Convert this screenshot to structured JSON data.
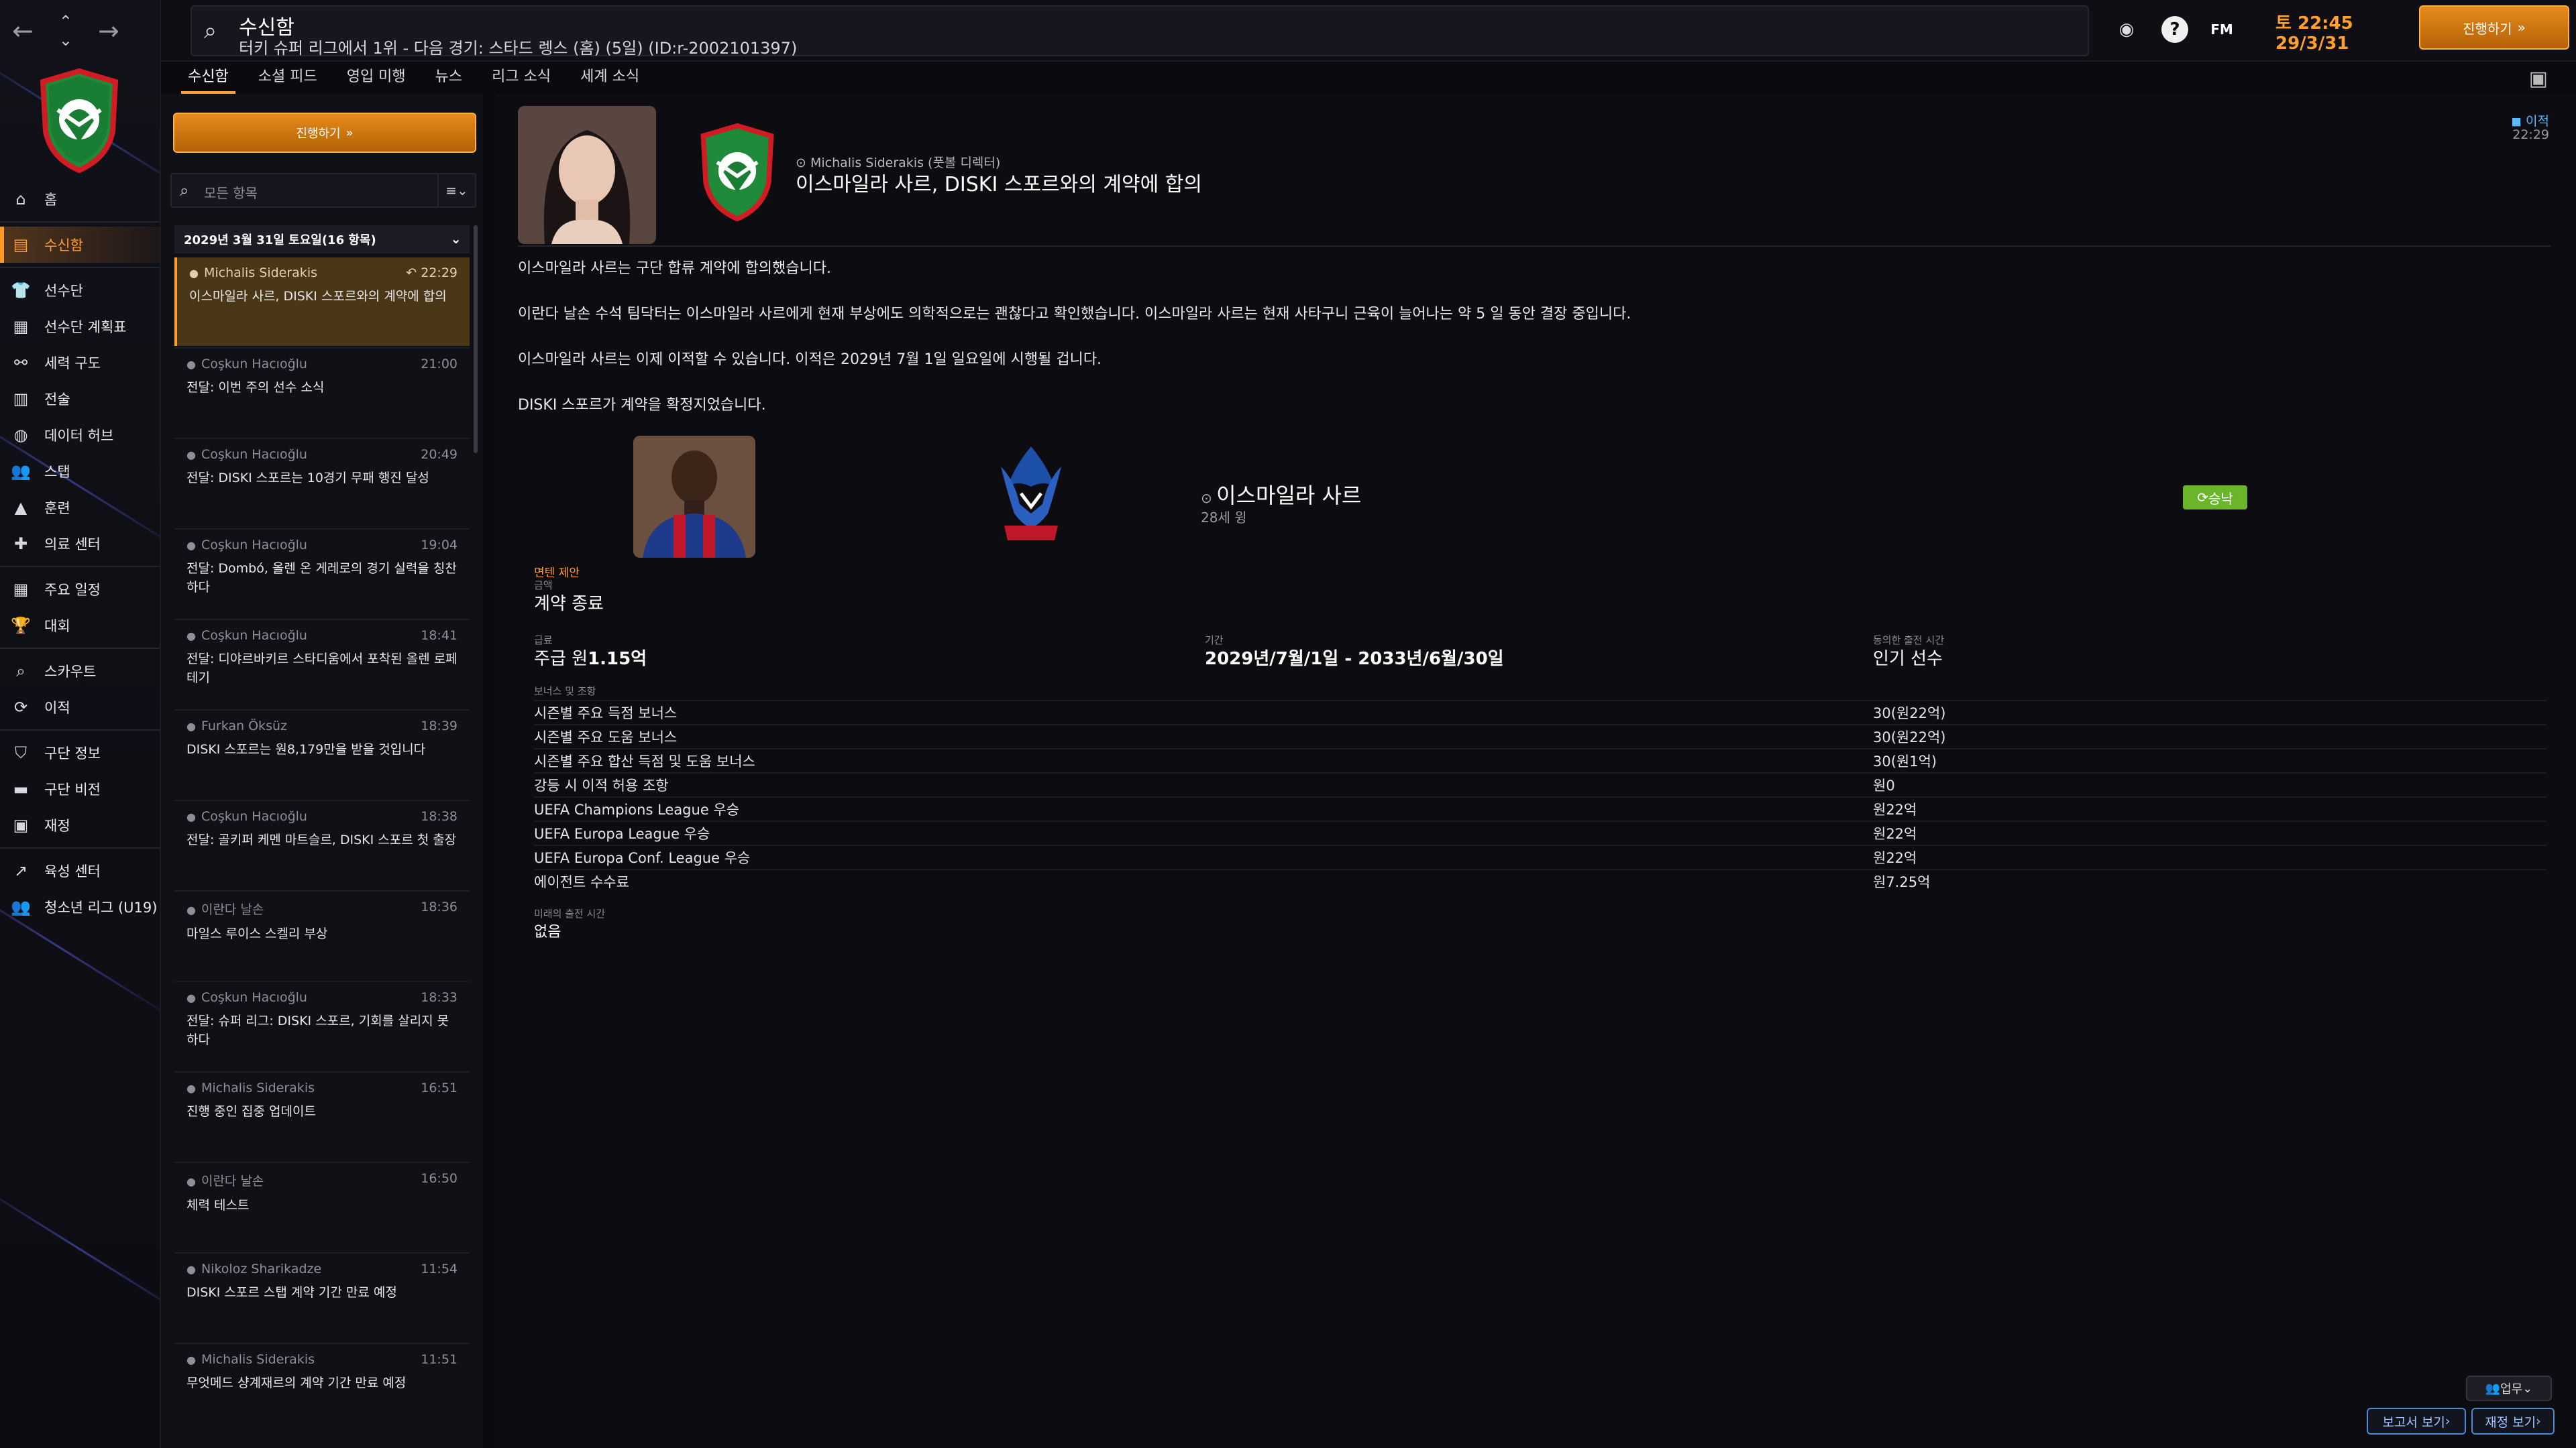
{
  "topbar": {
    "title": "수신함",
    "subtitle": "터키 슈퍼 리그에서 1위 - 다음 경기: 스타드 렝스 (홈) (5일) (ID:r-2002101397)",
    "fm_label": "FM",
    "day": "토 22:45",
    "date": "29/3/31",
    "continue_label": "진행하기"
  },
  "sidebar": {
    "items": [
      {
        "label": "홈",
        "icon": "home-icon"
      },
      {
        "label": "수신함",
        "icon": "inbox-icon",
        "active": true
      },
      {
        "label": "선수단",
        "icon": "squad-icon"
      },
      {
        "label": "선수단 계획표",
        "icon": "clipboard-icon"
      },
      {
        "label": "세력 구도",
        "icon": "dynamics-icon"
      },
      {
        "label": "전술",
        "icon": "tactics-icon"
      },
      {
        "label": "데이터 허브",
        "icon": "data-icon"
      },
      {
        "label": "스탭",
        "icon": "staff-icon"
      },
      {
        "label": "훈련",
        "icon": "training-icon"
      },
      {
        "label": "의료 센터",
        "icon": "medical-icon"
      },
      {
        "label": "주요 일정",
        "icon": "calendar-icon"
      },
      {
        "label": "대회",
        "icon": "trophy-icon"
      },
      {
        "label": "스카우트",
        "icon": "scout-icon"
      },
      {
        "label": "이적",
        "icon": "transfer-icon"
      },
      {
        "label": "구단 정보",
        "icon": "shield-icon"
      },
      {
        "label": "구단 비전",
        "icon": "vision-icon"
      },
      {
        "label": "재정",
        "icon": "finance-icon"
      },
      {
        "label": "육성 센터",
        "icon": "development-icon"
      },
      {
        "label": "청소년 리그 (U19)",
        "icon": "youth-icon"
      }
    ]
  },
  "tabs": [
    "수신함",
    "소셜 피드",
    "영입 미행",
    "뉴스",
    "리그 소식",
    "세계 소식"
  ],
  "list": {
    "continue_label": "진행하기",
    "filter_placeholder": "모든 항목",
    "day_header": "2029년 3월 31일 토요일(16 항목)",
    "messages": [
      {
        "from": "Michalis Siderakis",
        "time": "22:29",
        "subject": "이스마일라 사르, DISKI 스포르와의 계약에 합의"
      },
      {
        "from": "Coşkun Hacıoğlu",
        "time": "21:00",
        "subject": "전달: 이번 주의 선수 소식"
      },
      {
        "from": "Coşkun Hacıoğlu",
        "time": "20:49",
        "subject": "전달: DISKI 스포르는 10경기 무패 행진 달성"
      },
      {
        "from": "Coşkun Hacıoğlu",
        "time": "19:04",
        "subject": "전달: Dombó, 올렌 온 게레로의 경기 실력을 칭찬하다"
      },
      {
        "from": "Coşkun Hacıoğlu",
        "time": "18:41",
        "subject": "전달: 디야르바키르 스타디움에서 포착된 올렌 로페테기"
      },
      {
        "from": "Furkan Öksüz",
        "time": "18:39",
        "subject": "DISKI 스포르는 원8,179만을 받을 것입니다"
      },
      {
        "from": "Coşkun Hacıoğlu",
        "time": "18:38",
        "subject": "전달: 골키퍼 케멘 마트슬르, DISKI 스포르 첫 출장"
      },
      {
        "from": "이란다 날손",
        "time": "18:36",
        "subject": "마일스 루이스 스켈리 부상"
      },
      {
        "from": "Coşkun Hacıoğlu",
        "time": "18:33",
        "subject": "전달: 슈퍼 리그: DISKI 스포르, 기회를 살리지 못하다"
      },
      {
        "from": "Michalis Siderakis",
        "time": "16:51",
        "subject": "진행 중인 집중 업데이트"
      },
      {
        "from": "이란다 날손",
        "time": "16:50",
        "subject": "체력 테스트"
      },
      {
        "from": "Nikoloz Sharikadze",
        "time": "11:54",
        "subject": "DISKI 스포르 스탭 계약 기간 만료 예정"
      },
      {
        "from": "Michalis Siderakis",
        "time": "11:51",
        "subject": "무엇메드 샹계재르의 계약 기간 만료 예정"
      }
    ]
  },
  "message": {
    "sender": "Michalis Siderakis (풋볼 디렉터)",
    "headline": "이스마일라 사르, DISKI 스포르와의 계약에 합의",
    "badge": "이적",
    "time": "22:29",
    "paragraphs": [
      "이스마일라 사르는 구단 합류 계약에 합의했습니다.",
      "이란다 날손 수석 팀닥터는 이스마일라 사르에게 현재 부상에도 의학적으로는 괜찮다고 확인했습니다. 이스마일라 사르는 현재 사타구니 근육이 늘어나는 약 5 일 동안 결장 중입니다.",
      "이스마일라 사르는 이제 이적할 수 있습니다. 이적은 2029년 7월 1일 일요일에 시행될 겁니다.",
      "DISKI 스포르가 계약을 확정지었습니다."
    ],
    "player": {
      "name": "이스마일라 사르",
      "age": "28세 윙",
      "status": "승낙"
    },
    "offer": {
      "section": "면텐 제안",
      "fee_label": "금액",
      "fee_value": "계약 종료",
      "wage_label": "급료",
      "wage_prefix": "주급 원",
      "wage_value": "1.15억",
      "period_label": "기간",
      "period_value": "2029년/7월/1일 - 2033년/6월/30일",
      "playtime_label": "동의한 출전 시간",
      "playtime_value": "인기 선수",
      "bonus_label": "보너스 및 조항",
      "bonuses": [
        {
          "name": "시즌별 주요 득점 보너스",
          "value": "30(원22억)"
        },
        {
          "name": "시즌별 주요 도움 보너스",
          "value": "30(원22억)"
        },
        {
          "name": "시즌별 주요 합산 득점 및 도움 보너스",
          "value": "30(원1억)"
        },
        {
          "name": "강등 시 이적 허용 조항",
          "value": "원0"
        },
        {
          "name": "UEFA Champions League 우승",
          "value": "원22억"
        },
        {
          "name": "UEFA Europa League 우승",
          "value": "원22억"
        },
        {
          "name": "UEFA Europa Conf. League 우승",
          "value": "원22억"
        },
        {
          "name": "에이전트 수수료",
          "value": "원7.25억"
        }
      ],
      "min_playtime_label": "미래의 출전 시간",
      "min_playtime_value": "없음"
    }
  },
  "bottom": {
    "business_label": "업무",
    "report_label": "보고서 보기",
    "finance_label": "재정 보기"
  },
  "colors": {
    "accent": "#ff9f2f",
    "accept": "#6bb52a",
    "link": "#5cb8ff"
  }
}
